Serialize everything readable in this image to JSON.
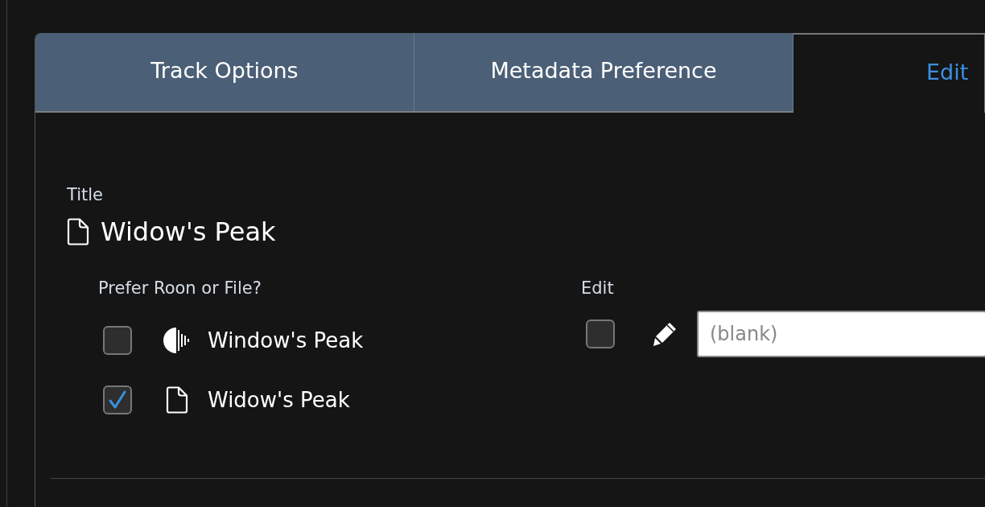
{
  "tabs": [
    {
      "label": "Track Options",
      "selected": false
    },
    {
      "label": "Metadata Preference",
      "selected": false
    },
    {
      "label": "Edit",
      "selected": true
    }
  ],
  "field": {
    "label": "Title",
    "value": "Widow's Peak"
  },
  "preference": {
    "label": "Prefer Roon or File?",
    "options": [
      {
        "kind": "roon",
        "label": "Window's Peak",
        "checked": false
      },
      {
        "kind": "file",
        "label": "Widow's Peak",
        "checked": true
      }
    ]
  },
  "edit": {
    "label": "Edit",
    "checked": false,
    "placeholder": "(blank)"
  }
}
